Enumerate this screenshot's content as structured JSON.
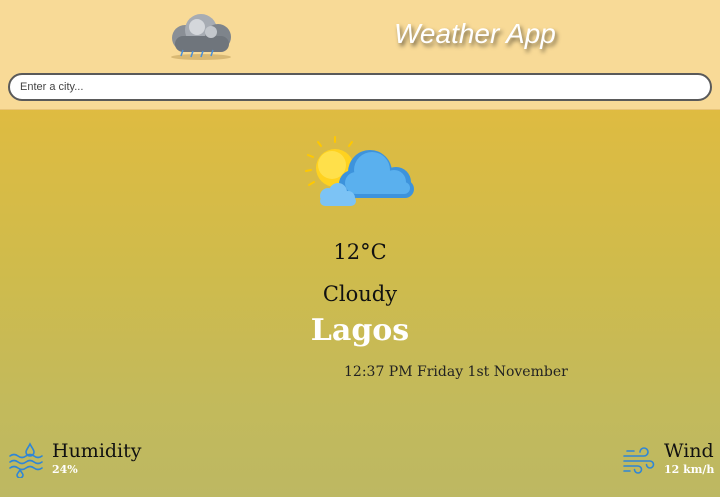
{
  "header": {
    "title": "Weather App",
    "logo_icon": "cloud-logo-icon"
  },
  "search": {
    "placeholder": "Enter a city...",
    "value": ""
  },
  "current": {
    "icon": "partly-cloudy-icon",
    "temperature": "12°C",
    "condition": "Cloudy",
    "city": "Lagos",
    "datetime": "12:37 PM Friday 1st November"
  },
  "details": {
    "humidity": {
      "label": "Humidity",
      "value": "24%",
      "icon": "humidity-icon"
    },
    "wind": {
      "label": "Wind",
      "value": "12 km/h",
      "icon": "wind-icon"
    }
  },
  "colors": {
    "header_bg": "#f8da97",
    "gradient_top": "#efb935",
    "gradient_bottom": "#bdb862",
    "icon_blue": "#3d93dc",
    "sun_yellow": "#ffd21f"
  }
}
